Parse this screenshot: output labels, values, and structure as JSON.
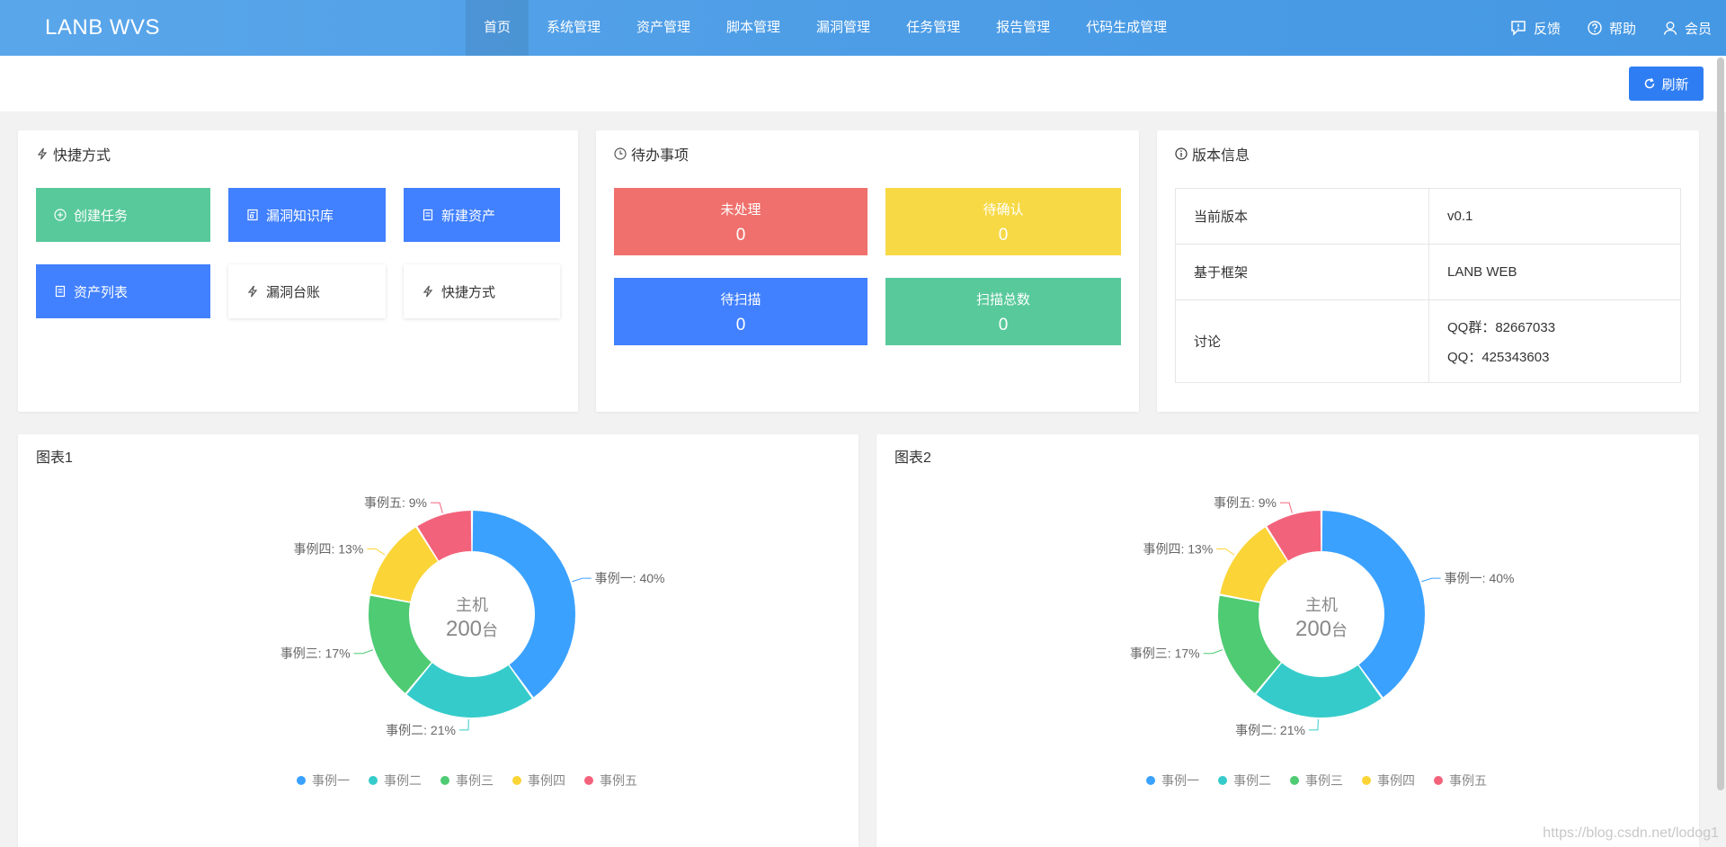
{
  "header": {
    "logo": "LANB WVS",
    "nav": [
      "首页",
      "系统管理",
      "资产管理",
      "脚本管理",
      "漏洞管理",
      "任务管理",
      "报告管理",
      "代码生成管理"
    ],
    "right_links": [
      {
        "label": "反馈",
        "icon": "feedback-icon"
      },
      {
        "label": "帮助",
        "icon": "help-icon"
      },
      {
        "label": "会员",
        "icon": "user-icon"
      }
    ]
  },
  "toolbar": {
    "refresh_label": "刷新"
  },
  "shortcuts": {
    "title": "快捷方式",
    "buttons": [
      {
        "label": "创建任务",
        "icon": "plus-circle-icon",
        "color": "#58c99b"
      },
      {
        "label": "漏洞知识库",
        "icon": "book-icon",
        "color": "#4180ff"
      },
      {
        "label": "新建资产",
        "icon": "document-icon",
        "color": "#4180ff"
      },
      {
        "label": "资产列表",
        "icon": "list-icon",
        "color": "#4180ff"
      },
      {
        "label": "漏洞台账",
        "icon": "lightning-icon",
        "color": "#ffffff"
      },
      {
        "label": "快捷方式",
        "icon": "lightning-icon",
        "color": "#ffffff"
      }
    ]
  },
  "todo": {
    "title": "待办事项",
    "items": [
      {
        "label": "未处理",
        "value": "0",
        "color": "#ef706c"
      },
      {
        "label": "待确认",
        "value": "0",
        "color": "#f7d945"
      },
      {
        "label": "待扫描",
        "value": "0",
        "color": "#4180ff"
      },
      {
        "label": "扫描总数",
        "value": "0",
        "color": "#58c99b"
      }
    ]
  },
  "version": {
    "title": "版本信息",
    "rows": [
      {
        "key": "当前版本",
        "value": "v0.1"
      },
      {
        "key": "基于框架",
        "value": "LANB WEB"
      },
      {
        "key": "讨论",
        "value": "QQ群：82667033",
        "value2": "QQ：425343603"
      }
    ]
  },
  "charts": [
    {
      "title": "图表1",
      "center_top": "主机",
      "center_value": "200",
      "center_unit": "台"
    },
    {
      "title": "图表2",
      "center_top": "主机",
      "center_value": "200",
      "center_unit": "台"
    }
  ],
  "chart_data": [
    {
      "type": "pie",
      "title": "图表1",
      "categories": [
        "事例一",
        "事例二",
        "事例三",
        "事例四",
        "事例五"
      ],
      "values": [
        40,
        21,
        17,
        13,
        9
      ],
      "unit": "%",
      "colors": [
        "#3aa1ff",
        "#36cbcb",
        "#4ecb73",
        "#fbd437",
        "#f2637b"
      ],
      "legend": "bottom",
      "donut": true
    },
    {
      "type": "pie",
      "title": "图表2",
      "categories": [
        "事例一",
        "事例二",
        "事例三",
        "事例四",
        "事例五"
      ],
      "values": [
        40,
        21,
        17,
        13,
        9
      ],
      "unit": "%",
      "colors": [
        "#3aa1ff",
        "#36cbcb",
        "#4ecb73",
        "#fbd437",
        "#f2637b"
      ],
      "legend": "bottom",
      "donut": true
    }
  ],
  "watermark": "https://blog.csdn.net/lodog1"
}
